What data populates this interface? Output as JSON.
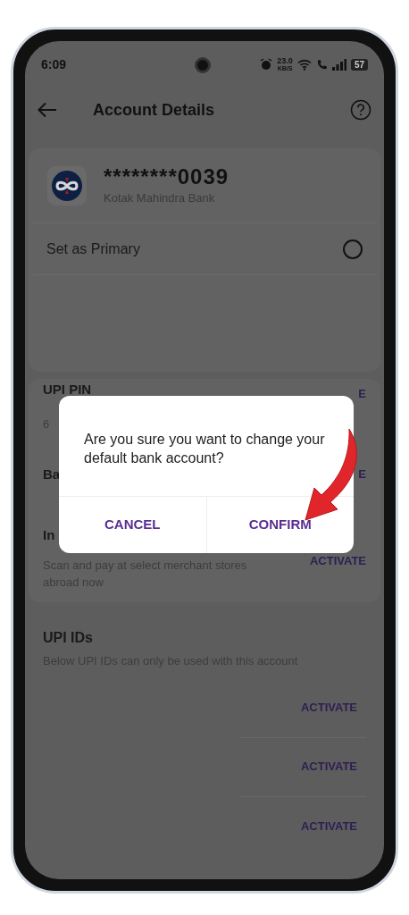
{
  "status_bar": {
    "time": "6:09",
    "net_speed": "23.0",
    "net_unit": "KB/S",
    "battery": "57"
  },
  "header": {
    "title": "Account Details"
  },
  "account": {
    "number": "********0039",
    "bank": "Kotak Mahindra Bank",
    "primary": {
      "label": "Set as Primary",
      "checked": false
    }
  },
  "settings_rows": [
    {
      "title": "UPI PIN",
      "subtitle": "6",
      "action": "E"
    },
    {
      "title": "Ba",
      "action": "E"
    },
    {
      "title": "In",
      "subtitle": "Scan and pay at select merchant stores abroad now",
      "action": "ACTIVATE"
    }
  ],
  "upi_ids": {
    "title": "UPI IDs",
    "subtitle": "Below UPI IDs can only be used with this account",
    "rows": [
      {
        "action": "ACTIVATE"
      },
      {
        "action": "ACTIVATE"
      },
      {
        "action": "ACTIVATE"
      }
    ]
  },
  "dialog": {
    "message": "Are you sure you want to change your default bank account?",
    "buttons": [
      "CANCEL",
      "CONFIRM"
    ]
  }
}
